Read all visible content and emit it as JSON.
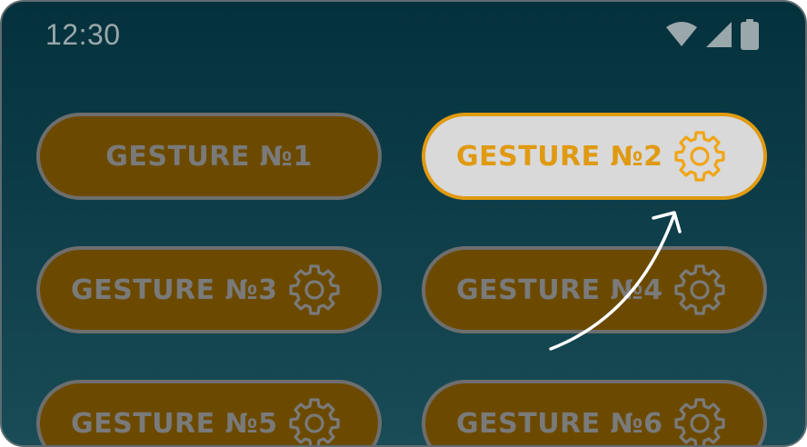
{
  "status_bar": {
    "time": "12:30",
    "icons": [
      "wifi-icon",
      "cellular-signal-icon",
      "battery-icon"
    ]
  },
  "colors": {
    "background_top": "#04313c",
    "background_bottom": "#194c56",
    "button_fill": "#6b4a00",
    "button_border": "#6e6e6e",
    "button_text": "#7a7a7a",
    "active_fill": "#d9d9d9",
    "active_accent": "#e09a12"
  },
  "gestures": [
    {
      "label": "GESTURE №1",
      "has_settings_icon": false,
      "active": false
    },
    {
      "label": "GESTURE №2",
      "has_settings_icon": true,
      "active": true
    },
    {
      "label": "GESTURE №3",
      "has_settings_icon": true,
      "active": false
    },
    {
      "label": "GESTURE №4",
      "has_settings_icon": true,
      "active": false
    },
    {
      "label": "GESTURE №5",
      "has_settings_icon": true,
      "active": false
    },
    {
      "label": "GESTURE №6",
      "has_settings_icon": true,
      "active": false
    }
  ]
}
